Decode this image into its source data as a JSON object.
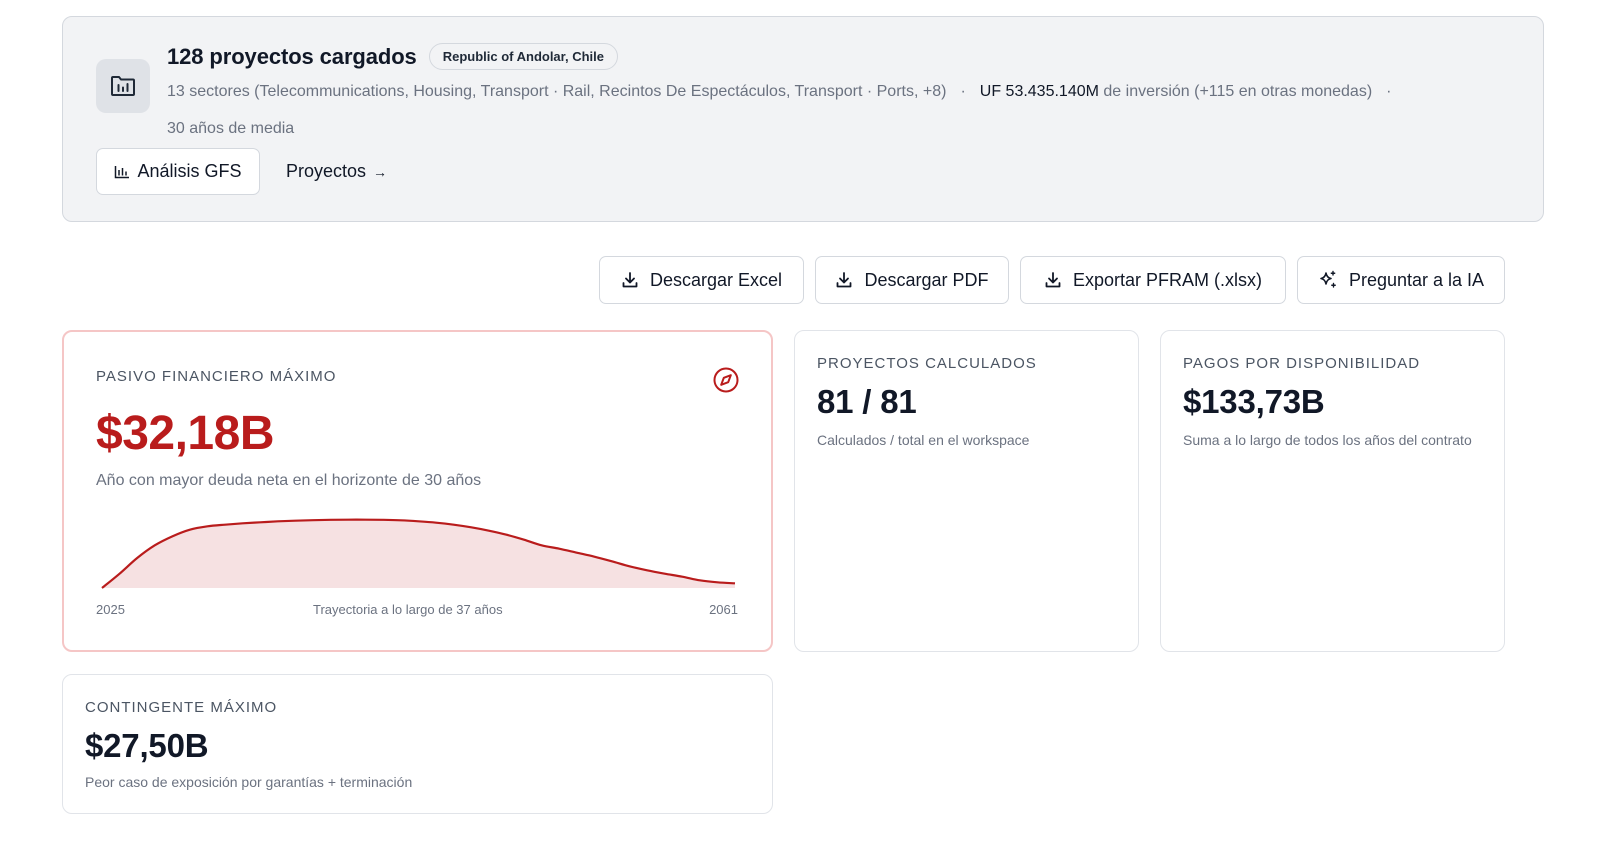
{
  "summary": {
    "title": "128 proyectos cargados",
    "badge": "Republic of Andolar, Chile",
    "sectors": "13 sectores (Telecommunications, Housing, Transport · Rail, Recintos De Espectáculos, Transport · Ports, +8)",
    "investment_amount": "UF 53.435.140M",
    "investment_suffix": "de inversión (+115 en otras monedas)",
    "average_years": "30 años de media",
    "separator": "·",
    "gfs_button": "Análisis GFS",
    "projects_link": "Proyectos",
    "projects_arrow": "→"
  },
  "actions": {
    "excel": "Descargar Excel",
    "pdf": "Descargar PDF",
    "pfram": "Exportar PFRAM (.xlsx)",
    "ai": "Preguntar a la IA"
  },
  "cards": {
    "pasivo": {
      "kicker": "PASIVO FINANCIERO MÁXIMO",
      "value": "$32,18B",
      "description": "Año con mayor deuda neta en el horizonte de 30 años",
      "axis_start": "2025",
      "axis_mid": "Trayectoria a lo largo de 37 años",
      "axis_end": "2061"
    },
    "proyectos": {
      "kicker": "PROYECTOS CALCULADOS",
      "value": "81 / 81",
      "sub": "Calculados / total en el workspace"
    },
    "pagos": {
      "kicker": "PAGOS POR DISPONIBILIDAD",
      "value": "$133,73B",
      "sub": "Suma a lo largo de todos los años del contrato"
    },
    "contingente": {
      "kicker": "CONTINGENTE MÁXIMO",
      "value": "$27,50B",
      "sub": "Peor caso de exposición por garantías + terminación"
    }
  },
  "colors": {
    "accent_red": "#b91c1c",
    "sparkline_fill": "#f6e1e2",
    "card_highlight_border": "#f5c6c6"
  },
  "chart_data": {
    "type": "area",
    "x": [
      2025,
      2026,
      2027,
      2028,
      2029,
      2030,
      2031,
      2032,
      2033,
      2034,
      2035,
      2036,
      2037,
      2038,
      2039,
      2040,
      2041,
      2042,
      2043,
      2044,
      2045,
      2046,
      2047,
      2048,
      2049,
      2050,
      2051,
      2052,
      2053,
      2054,
      2055,
      2056,
      2057,
      2058,
      2059,
      2060,
      2061
    ],
    "values": [
      0.0,
      4.3,
      9.0,
      12.8,
      15.5,
      17.5,
      18.5,
      19.0,
      19.4,
      19.7,
      20.0,
      20.2,
      20.35,
      20.45,
      20.5,
      20.5,
      20.45,
      20.3,
      20.0,
      19.6,
      19.0,
      18.2,
      17.2,
      16.0,
      14.5,
      12.8,
      11.8,
      10.6,
      9.4,
      8.0,
      6.5,
      5.3,
      4.3,
      3.4,
      2.3,
      1.7,
      1.4
    ],
    "ylim": [
      0,
      21
    ],
    "title": "",
    "xlabel": "Trayectoria a lo largo de 37 años",
    "ylabel": "",
    "grid": false,
    "note": "Sparkline sin escala vertical impresa; valores relativos estimados de la forma."
  }
}
